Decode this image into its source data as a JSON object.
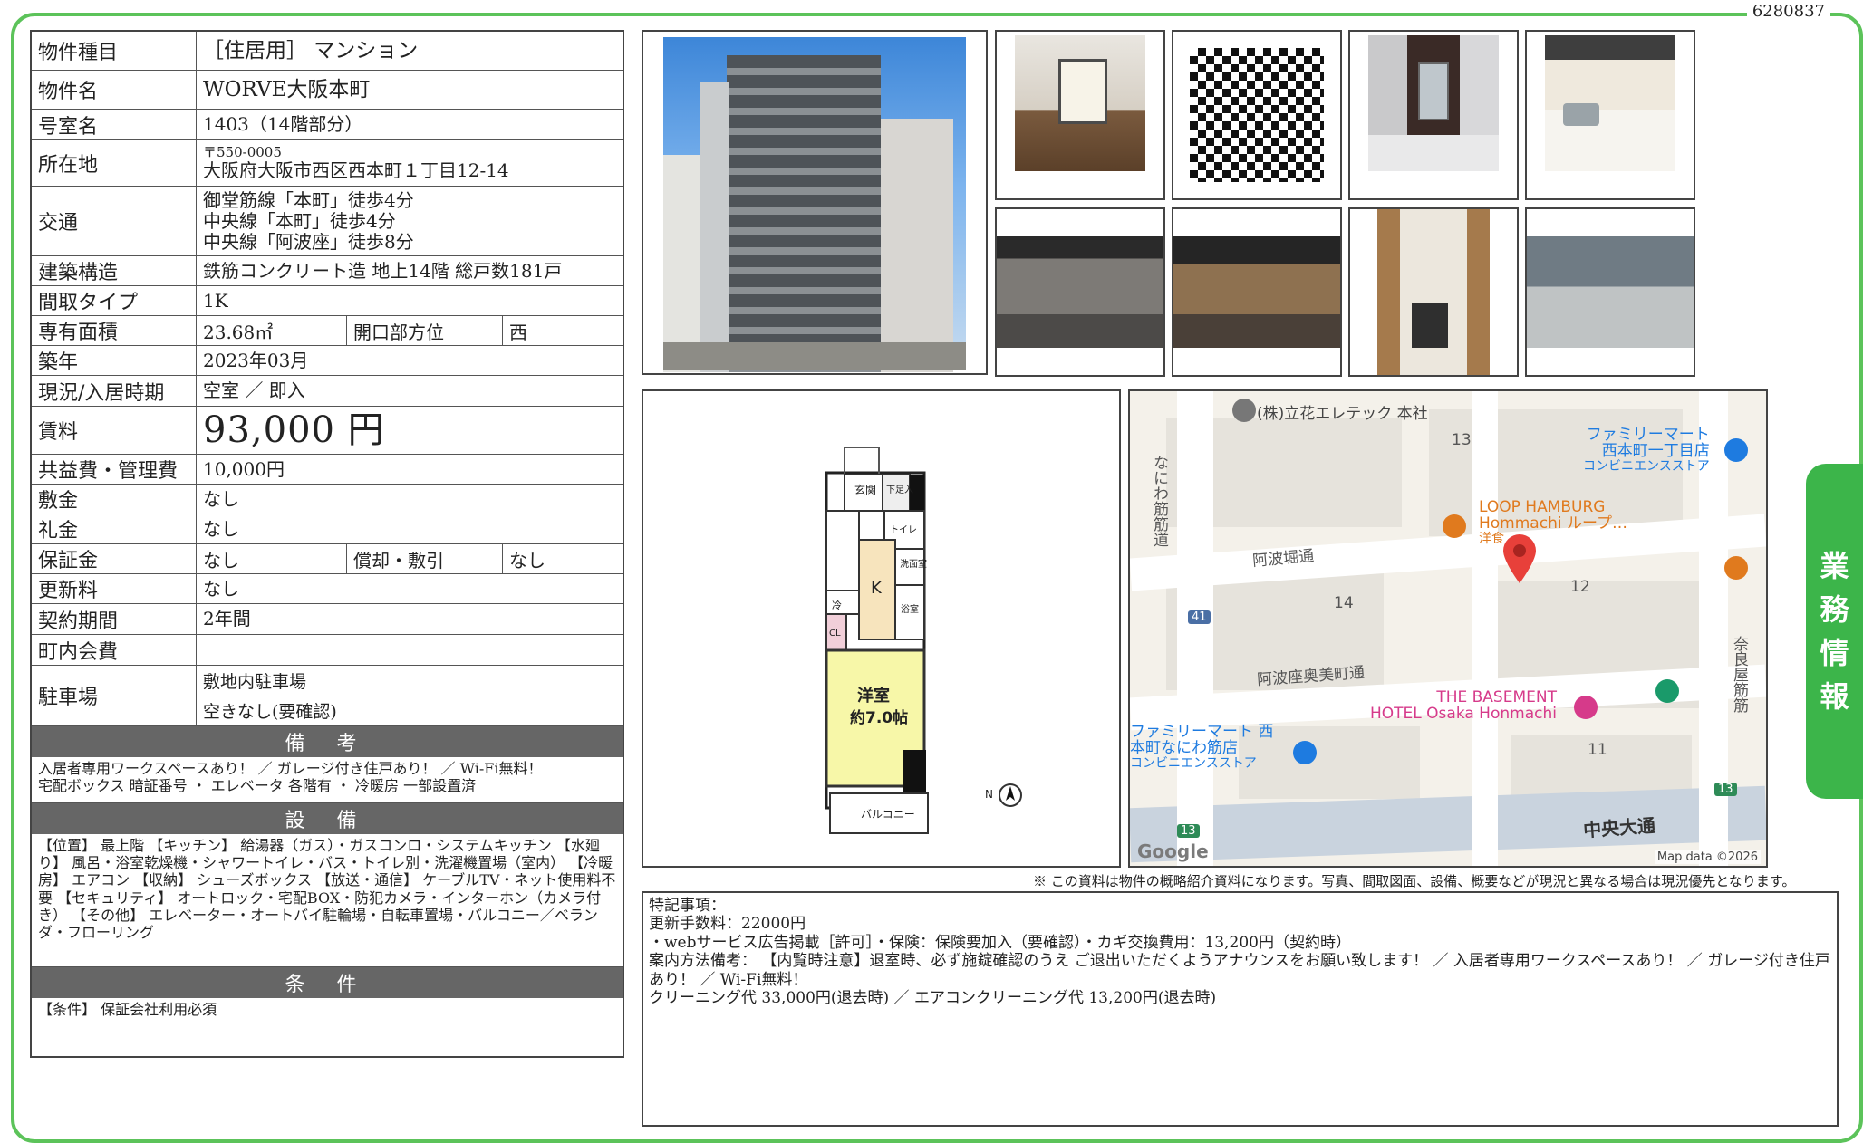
{
  "doc_id": "6280837",
  "info": {
    "type_label": "物件種目",
    "type_value": "［住居用］ マンション",
    "name_label": "物件名",
    "name_value": "WORVE大阪本町",
    "room_label": "号室名",
    "room_value": "1403（14階部分）",
    "address_label": "所在地",
    "address_zip": "〒550-0005",
    "address_value": "大阪府大阪市西区西本町１丁目12-14",
    "access_label": "交通",
    "access_lines": [
      "御堂筋線「本町」徒歩4分",
      "中央線「本町」徒歩4分",
      "中央線「阿波座」徒歩8分"
    ],
    "structure_label": "建築構造",
    "structure_value": "鉄筋コンクリート造 地上14階 総戸数181戸",
    "layout_label": "間取タイプ",
    "layout_value": "1K",
    "area_label": "専有面積",
    "area_value": "23.68㎡",
    "direction_label": "開口部方位",
    "direction_value": "西",
    "built_label": "築年",
    "built_value": "2023年03月",
    "status_label": "現況/入居時期",
    "status_value": "空室 ／ 即入",
    "rent_label": "賃料",
    "rent_value": "93,000 円",
    "fee_label": "共益費・管理費",
    "fee_value": "10,000円",
    "deposit_label": "敷金",
    "deposit_value": "なし",
    "keymoney_label": "礼金",
    "keymoney_value": "なし",
    "guarantee_label": "保証金",
    "guarantee_value": "なし",
    "amort_label": "償却・敷引",
    "amort_value": "なし",
    "renewal_label": "更新料",
    "renewal_value": "なし",
    "contract_label": "契約期間",
    "contract_value": "2年間",
    "town_label": "町内会費",
    "town_value": "",
    "parking_label": "駐車場",
    "parking_value1": "敷地内駐車場",
    "parking_value2": "空きなし(要確認)"
  },
  "sections": {
    "remarks_title": "備 考",
    "remarks_text": "入居者専用ワークスペースあり！ ／ ガレージ付き住戸あり！ ／ Wi-Fi無料！\n宅配ボックス 暗証番号 ・ エレベータ 各階有 ・ 冷暖房 一部設置済",
    "equip_title": "設 備",
    "equip_text": "【位置】 最上階 【キッチン】 給湯器（ガス）・ガスコンロ・システムキッチン 【水廻り】 風呂・浴室乾燥機・シャワートイレ・バス・トイレ別・洗濯機置場（室内） 【冷暖房】 エアコン 【収納】 シューズボックス 【放送・通信】 ケーブルTV・ネット使用料不要 【セキュリティ】 オートロック・宅配BOX・防犯カメラ・インターホン（カメラ付き） 【その他】 エレベーター・オートバイ駐輪場・自転車置場・バルコニー／ベランダ・フローリング",
    "cond_title": "条 件",
    "cond_text": "【条件】 保証会社利用必須"
  },
  "floorplan": {
    "room_name": "洋室",
    "room_size": "約7.0帖",
    "balcony": "バルコニー",
    "kitchen": "K",
    "entrance": "玄関",
    "shoe": "下足入",
    "toilet": "トイレ",
    "washroom": "洗面室",
    "bath": "浴室",
    "closet": "CL",
    "fridge": "冷",
    "north": "N"
  },
  "map": {
    "poi1": "(株)立花エレテック 本社",
    "poi2a": "ファミリーマート",
    "poi2b": "西本町一丁目店",
    "poi2c": "コンビニエンスストア",
    "poi3a": "LOOP HAMBURG",
    "poi3b": "Hommachi ループ…",
    "poi3c": "洋食",
    "poi4a": "THE BASEMENT",
    "poi4b": "HOTEL Osaka Honmachi",
    "poi5a": "ファミリーマート 西",
    "poi5b": "本町なにわ筋店",
    "poi5c": "コンビニエンスストア",
    "street1": "阿波堀通",
    "street2": "阿波座奥美町通",
    "street3": "中央大通",
    "street4": "なにわ筋筋道",
    "street5": "奈良屋筋筋",
    "n13": "13",
    "n12": "12",
    "n14": "14",
    "n11": "11",
    "r41": "41",
    "r13a": "13",
    "r13b": "13",
    "google": "Google",
    "mapdata": "Map data ©2026"
  },
  "note": "※ この資料は物件の概略紹介資料になります。写真、間取図面、設備、概要などが現況と異なる場合は現況優先となります。",
  "special": {
    "l1": "特記事項：",
    "l2": "更新手数料：22000円",
    "l3": "・webサービス広告掲載［許可］・保険：保険要加入（要確認）・カギ交換費用：13,200円（契約時）",
    "l4": "案内方法備考： 【内覧時注意】退室時、必ず施錠確認のうえ ご退出いただくようアナウンスをお願い致します！ ／ 入居者専用ワークスペースあり！ ／ ガレージ付き住戸あり！ ／ Wi-Fi無料！",
    "l5": "クリーニング代 33,000円(退去時) ／ エアコンクリーニング代 13,200円(退去時)"
  },
  "side_tab": [
    "業",
    "務",
    "情",
    "報"
  ]
}
